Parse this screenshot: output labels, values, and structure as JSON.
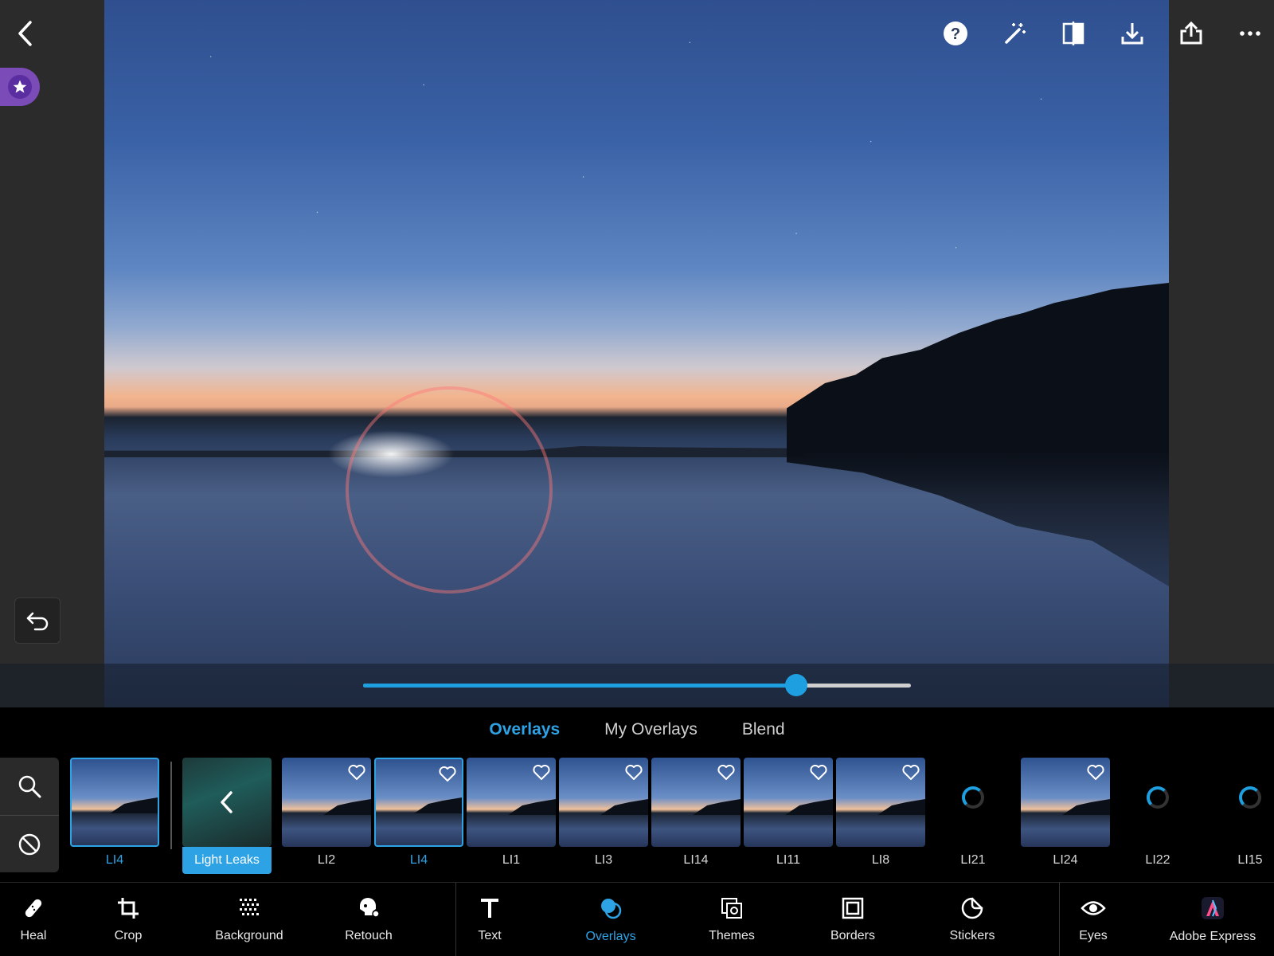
{
  "top_toolbar": {
    "icons": [
      "help-icon",
      "auto-fix-icon",
      "compare-icon",
      "download-icon",
      "share-icon",
      "more-icon"
    ]
  },
  "overlay_tabs": [
    {
      "label": "Overlays",
      "active": true
    },
    {
      "label": "My Overlays",
      "active": false
    },
    {
      "label": "Blend",
      "active": false
    }
  ],
  "slider": {
    "value": 0.79
  },
  "category": {
    "label": "Light Leaks"
  },
  "current_overlay": {
    "label": "LI4"
  },
  "thumbnails": [
    {
      "label": "LI2",
      "selected": false,
      "loading": false
    },
    {
      "label": "LI4",
      "selected": true,
      "loading": false
    },
    {
      "label": "LI1",
      "selected": false,
      "loading": false
    },
    {
      "label": "LI3",
      "selected": false,
      "loading": false
    },
    {
      "label": "LI14",
      "selected": false,
      "loading": false
    },
    {
      "label": "LI11",
      "selected": false,
      "loading": false
    },
    {
      "label": "LI8",
      "selected": false,
      "loading": false
    },
    {
      "label": "LI21",
      "selected": false,
      "loading": true
    },
    {
      "label": "LI24",
      "selected": false,
      "loading": false
    },
    {
      "label": "LI22",
      "selected": false,
      "loading": true
    },
    {
      "label": "LI15",
      "selected": false,
      "loading": true
    }
  ],
  "bottom_nav": [
    {
      "label": "Heal",
      "icon": "bandage-icon",
      "active": false
    },
    {
      "label": "Crop",
      "icon": "crop-icon",
      "active": false
    },
    {
      "label": "Background",
      "icon": "background-icon",
      "active": false
    },
    {
      "label": "Retouch",
      "icon": "retouch-icon",
      "active": false
    },
    {
      "label": "Text",
      "icon": "text-icon",
      "active": false
    },
    {
      "label": "Overlays",
      "icon": "overlays-icon",
      "active": true
    },
    {
      "label": "Themes",
      "icon": "themes-icon",
      "active": false
    },
    {
      "label": "Borders",
      "icon": "borders-icon",
      "active": false
    },
    {
      "label": "Stickers",
      "icon": "stickers-icon",
      "active": false
    },
    {
      "label": "Eyes",
      "icon": "eye-icon",
      "active": false
    },
    {
      "label": "Adobe Express",
      "icon": "adobe-express-icon",
      "active": false
    }
  ],
  "colors": {
    "accent": "#2da3e6",
    "premium": "#7b4bb8"
  }
}
